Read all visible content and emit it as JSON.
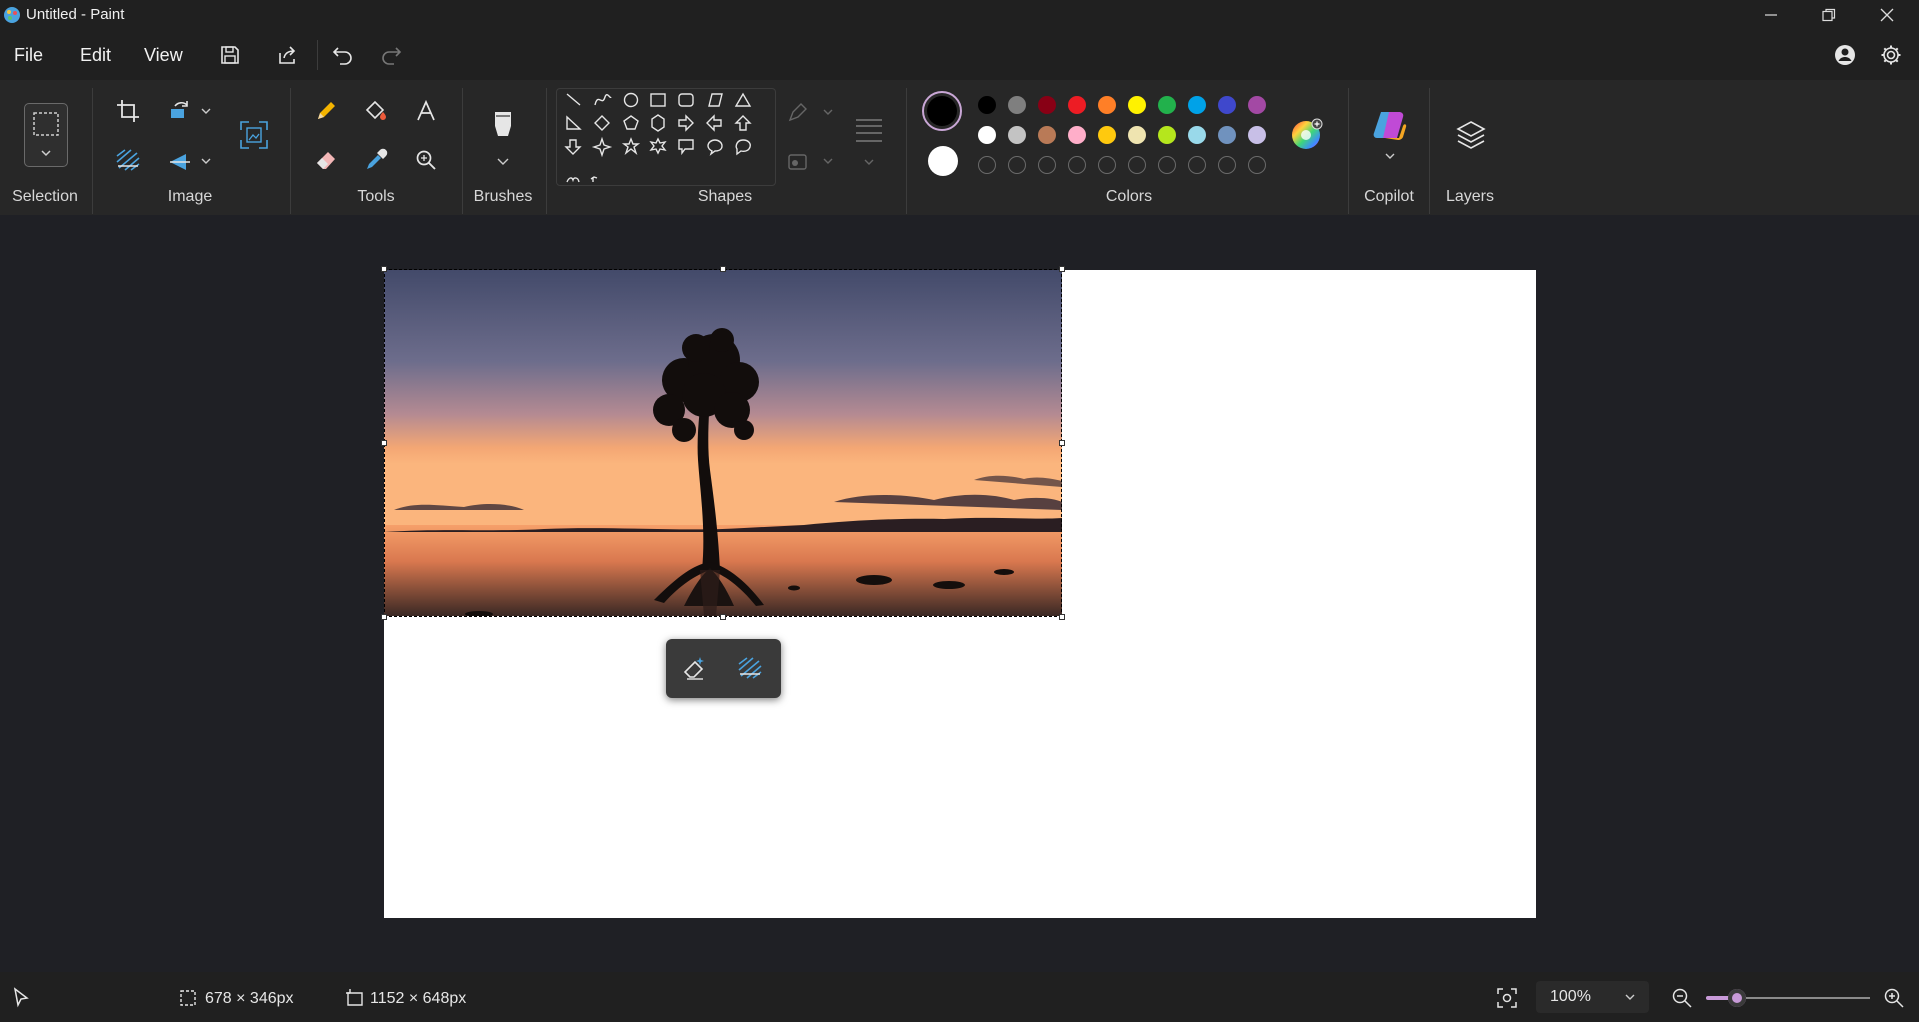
{
  "window": {
    "title": "Untitled - Paint",
    "minimize_icon": "minimize-icon",
    "restore_icon": "restore-icon",
    "close_icon": "close-icon"
  },
  "menu": {
    "file": "File",
    "edit": "Edit",
    "view": "View"
  },
  "quick_access": [
    "save-icon",
    "share-icon",
    "undo-icon",
    "redo-icon"
  ],
  "account": {
    "profile_icon": "profile-icon",
    "settings_icon": "gear-icon"
  },
  "ribbon": {
    "groups": {
      "selection": "Selection",
      "image": "Image",
      "tools": "Tools",
      "brushes": "Brushes",
      "shapes": "Shapes",
      "colors": "Colors",
      "copilot": "Copilot",
      "layers": "Layers"
    }
  },
  "colors": {
    "primary": "#000000",
    "secondary": "#ffffff",
    "row1": [
      "#000000",
      "#7f7f7f",
      "#880015",
      "#ed1c24",
      "#ff7f27",
      "#fff200",
      "#22b14c",
      "#00a2e8",
      "#3f48cc",
      "#a349a4"
    ],
    "row2": [
      "#ffffff",
      "#c3c3c3",
      "#b97a57",
      "#ffaec9",
      "#ffc90e",
      "#efe4b0",
      "#b5e61d",
      "#99d9ea",
      "#7092be",
      "#c8bfe7"
    ],
    "row3_empty_count": 10
  },
  "status": {
    "selection_size": "678 × 346px",
    "canvas_size": "1152 × 648px",
    "zoom": "100%",
    "zoom_level": 0.15
  }
}
